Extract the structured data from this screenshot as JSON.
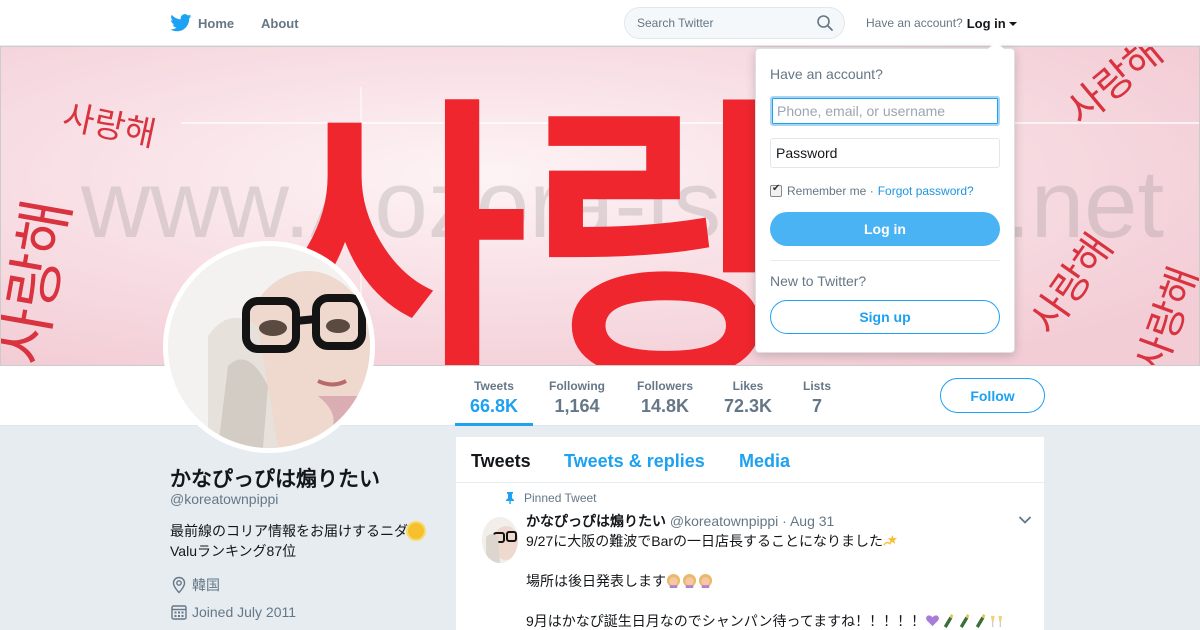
{
  "nav": {
    "home_label": "Home",
    "about_label": "About",
    "search_placeholder": "Search Twitter",
    "have_account_prefix": "Have an account?",
    "login_label": "Log in",
    "brand_color": "#1da1f2"
  },
  "banner": {
    "hangul_main": "사랑",
    "hangul_small": "사랑해",
    "watermark": "www.Aozora-tsuushin.net"
  },
  "stats": [
    {
      "label": "Tweets",
      "value": "66.8K",
      "active": true
    },
    {
      "label": "Following",
      "value": "1,164"
    },
    {
      "label": "Followers",
      "value": "14.8K"
    },
    {
      "label": "Likes",
      "value": "72.3K"
    },
    {
      "label": "Lists",
      "value": "7"
    }
  ],
  "follow_label": "Follow",
  "profile": {
    "name": "かなぴっぴは煽りたい",
    "handle": "@koreatownpippi",
    "bio_line1": "最前線のコリア情報をお届けするニダ",
    "bio_line2": "Valuランキング87位",
    "location": "韓国",
    "joined": "Joined July 2011"
  },
  "timeline": {
    "tabs": [
      "Tweets",
      "Tweets & replies",
      "Media"
    ],
    "pinned_label": "Pinned Tweet",
    "tweet": {
      "name": "かなぴっぴは煽りたい",
      "handle": "@koreatownpippi",
      "date": "· Aug 31",
      "line1": "9/27に大阪の難波でBarの一日店長することになりました",
      "line2": "場所は後日発表します",
      "line3": "9月はかなぴ誕生日月なのでシャンパン待ってますね！！！！！"
    }
  },
  "login_dropdown": {
    "title": "Have an account?",
    "user_placeholder": "Phone, email, or username",
    "password_placeholder": "Password",
    "remember_label": "Remember me ·",
    "forgot_label": "Forgot password?",
    "login_button": "Log in",
    "new_label": "New to Twitter?",
    "signup_button": "Sign up"
  }
}
